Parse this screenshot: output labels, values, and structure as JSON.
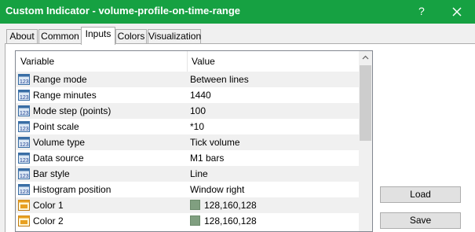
{
  "window": {
    "title": "Custom Indicator - volume-profile-on-time-range",
    "help_label": "?",
    "colors": {
      "titlebar": "#16a142",
      "alt_row": "#f0f0f0",
      "swatch": "#809f80"
    }
  },
  "tabs": [
    {
      "label": "About",
      "active": false
    },
    {
      "label": "Common",
      "active": false
    },
    {
      "label": "Inputs",
      "active": true
    },
    {
      "label": "Colors",
      "active": false
    },
    {
      "label": "Visualization",
      "active": false
    }
  ],
  "table": {
    "headers": {
      "variable": "Variable",
      "value": "Value"
    },
    "rows": [
      {
        "icon": "number-icon",
        "name": "Range mode",
        "value": "Between lines"
      },
      {
        "icon": "number-icon",
        "name": "Range minutes",
        "value": "1440"
      },
      {
        "icon": "number-icon",
        "name": "Mode step (points)",
        "value": "100"
      },
      {
        "icon": "number-icon",
        "name": "Point scale",
        "value": "*10"
      },
      {
        "icon": "number-icon",
        "name": "Volume type",
        "value": "Tick volume"
      },
      {
        "icon": "number-icon",
        "name": "Data source",
        "value": "M1 bars"
      },
      {
        "icon": "number-icon",
        "name": "Bar style",
        "value": "Line"
      },
      {
        "icon": "number-icon",
        "name": "Histogram position",
        "value": "Window right"
      },
      {
        "icon": "color-icon",
        "name": "Color 1",
        "value": "128,160,128",
        "color": "#809f80"
      },
      {
        "icon": "color-icon",
        "name": "Color 2",
        "value": "128,160,128",
        "color": "#809f80"
      }
    ]
  },
  "buttons": {
    "load": "Load",
    "save": "Save"
  }
}
